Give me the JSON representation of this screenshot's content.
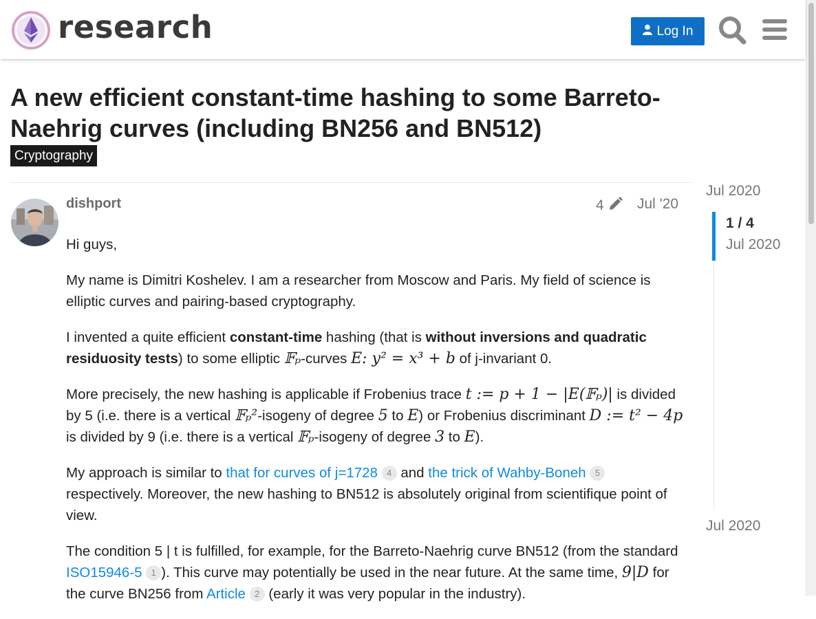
{
  "header": {
    "site_name": "research",
    "login_label": "Log In",
    "icons": {
      "logo": "ethereum-logo",
      "search": "search-icon",
      "menu": "hamburger-menu-icon",
      "login": "person-icon"
    },
    "accent_color": "#0f6fc6"
  },
  "topic": {
    "title": "A new efficient constant-time hashing to some Barreto-Naehrig curves (including BN256 and BN512)",
    "category": "Cryptography"
  },
  "post": {
    "username": "dishport",
    "edit_count": "4",
    "date": "Jul '20",
    "p1": "Hi guys,",
    "p2": "My name is Dimitri Koshelev. I am a researcher from Moscow and Paris. My field of science is elliptic curves and pairing-based cryptography.",
    "p3": {
      "t1": "I invented a quite efficient ",
      "b1": "constant-time",
      "t2": " hashing (that is ",
      "b2": "without inversions and quadratic residuosity tests",
      "t3": ") to some elliptic ",
      "m1": "𝔽ₚ",
      "t4": "-curves ",
      "m2": "E: y² = x³ + b",
      "t5": " of j-invariant 0."
    },
    "p4": {
      "t1": "More precisely, the new hashing is applicable if Frobenius trace ",
      "m1": "t := p + 1 − |E(𝔽ₚ)|",
      "t2": " is divided by 5 (i.e. there is a vertical ",
      "m2": "𝔽ₚ²",
      "t3": "-isogeny of degree ",
      "m3": "5",
      "t4": " to ",
      "m4": "E",
      "t5": ") or Frobenius discriminant ",
      "m5": "D := t² − 4p",
      "t6": " is divided by 9 (i.e. there is a vertical ",
      "m6": "𝔽ₚ",
      "t7": "-isogeny of degree ",
      "m7": "3",
      "t8": " to ",
      "m8": "E",
      "t9": ")."
    },
    "p5": {
      "t1": "My approach is similar to ",
      "link1": "that for curves of j=1728",
      "link1_clicks": "4",
      "t2": " and ",
      "link2": "the trick of Wahby-Boneh",
      "link2_clicks": "5",
      "t3": " respectively. Moreover, the new hashing to BN512 is absolutely original from scientifique point of view."
    },
    "p6": {
      "t1": "The condition 5 | t is fulfilled, for example, for the Barreto-Naehrig curve BN512 (from the standard ",
      "link1": "ISO15946-5",
      "link1_clicks": "1",
      "t2": "). This curve may potentially be used in the near future. At the same time, ",
      "m1": "9|D",
      "t3": " for the curve BN256 from ",
      "link2": "Article",
      "link2_clicks": "2",
      "t4": " (early it was very popular in the industry)."
    }
  },
  "timeline": {
    "top_date": "Jul 2020",
    "counter": "1 / 4",
    "handle_date": "Jul 2020",
    "bottom_date": "Jul 2020"
  }
}
